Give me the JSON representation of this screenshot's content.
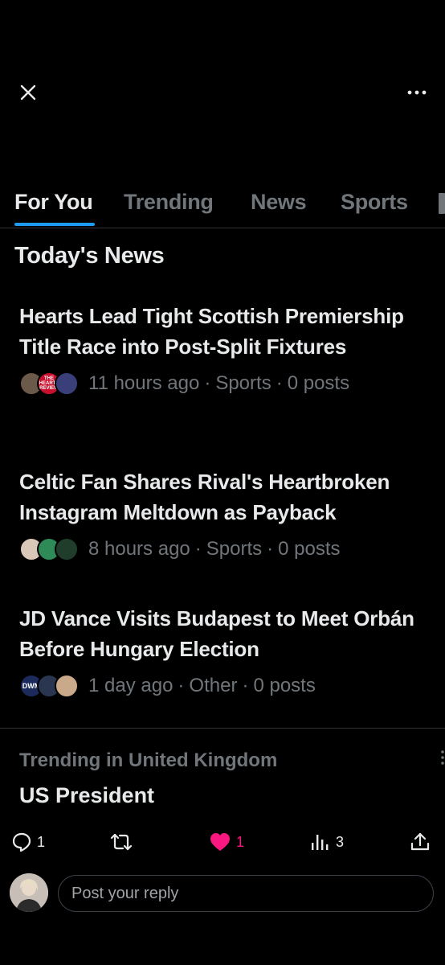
{
  "header": {
    "close_icon": "close-icon",
    "more_icon": "more-horizontal-icon"
  },
  "tabs": [
    {
      "label": "For You",
      "active": true
    },
    {
      "label": "Trending",
      "active": false
    },
    {
      "label": "News",
      "active": false
    },
    {
      "label": "Sports",
      "active": false
    }
  ],
  "section_title": "Today's News",
  "stories": [
    {
      "title": "Hearts Lead Tight Scottish Premiership Title Race into Post-Split Fixtures",
      "time": "11 hours ago",
      "category": "Sports",
      "posts": "0 posts",
      "avatar_badge": "THE HEARTS REVIEW"
    },
    {
      "title": "Celtic Fan Shares Rival's Heartbroken Instagram Meltdown as Payback",
      "time": "8 hours ago",
      "category": "Sports",
      "posts": "0 posts"
    },
    {
      "title": "JD Vance Visits Budapest to Meet Orbán Before Hungary Election",
      "time": "1 day ago",
      "category": "Other",
      "posts": "0 posts",
      "avatar_badge": "DWM"
    }
  ],
  "trending": {
    "context": "Trending in United Kingdom",
    "name": "US President"
  },
  "actions": {
    "reply_count": "1",
    "repost_count": "",
    "like_count": "1",
    "views_count": "3",
    "like_color": "#f91880"
  },
  "reply": {
    "placeholder": "Post your reply"
  },
  "colors": {
    "accent": "#1d9bf0",
    "muted": "#71767b",
    "background": "#000000"
  }
}
